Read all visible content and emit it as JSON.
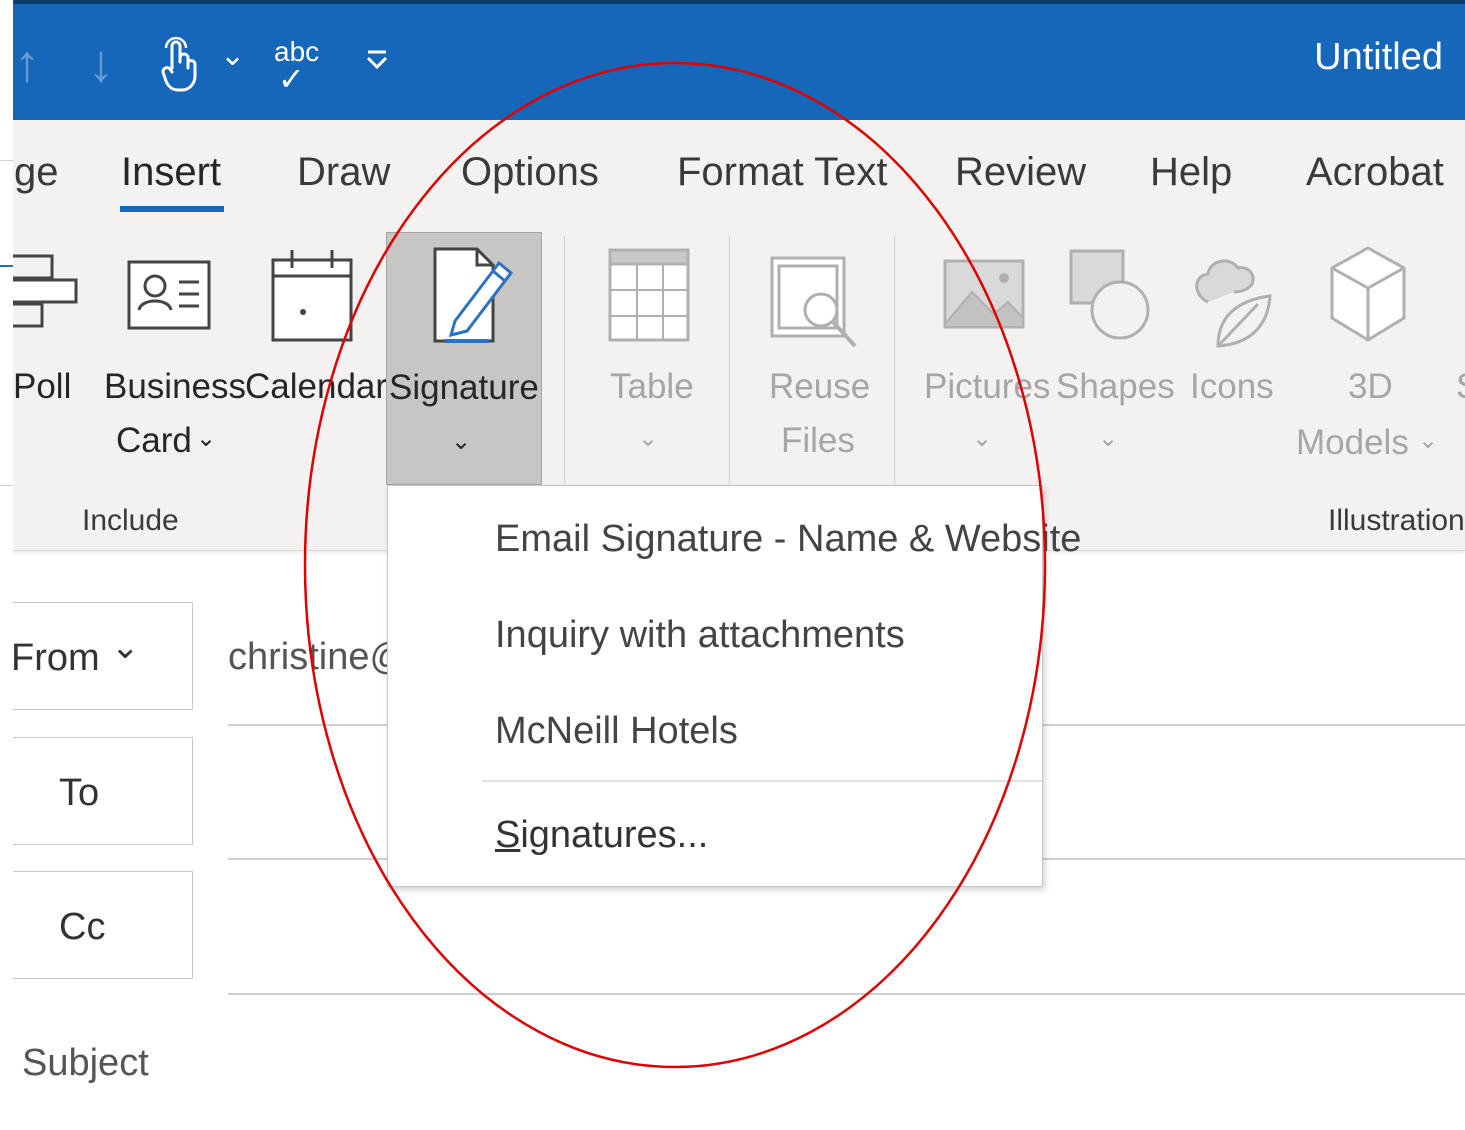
{
  "window": {
    "title": "Untitled"
  },
  "quick_access": {
    "undo": "↑",
    "redo": "↓",
    "touch": "☝",
    "touch_dropdown": "⌄",
    "spelling_top": "abc",
    "spelling_check": "✓",
    "customize": "⏷"
  },
  "tabs": [
    "ge",
    "Insert",
    "Draw",
    "Options",
    "Format Text",
    "Review",
    "Help",
    "Acrobat"
  ],
  "active_tab": "Insert",
  "ribbon": {
    "poll": "Poll",
    "business_card_1": "Business",
    "business_card_2": "Card",
    "calendar": "Calendar",
    "signature": "Signature",
    "table": "Table",
    "reuse_files_1": "Reuse",
    "reuse_files_2": "Files",
    "pictures": "Pictures",
    "shapes": "Shapes",
    "icons": "Icons",
    "models_1": "3D",
    "models_2": "Models",
    "chevron": "⌄",
    "group_include": "Include",
    "group_illustrations": "Illustration"
  },
  "signature_menu": {
    "items": [
      "Email Signature - Name & Website",
      "Inquiry with attachments",
      "McNeill Hotels"
    ],
    "manage_prefix": "S",
    "manage_rest": "ignatures..."
  },
  "compose": {
    "from_label": "From",
    "from_chevron": "⌄",
    "from_value": "christine@",
    "to_label": "To",
    "cc_label": "Cc",
    "subject_label": "Subject"
  },
  "colors": {
    "titlebar": "#1667b9",
    "ribbon": "#f3f2f1",
    "accent": "#1667b9",
    "annotation_oval": "#e00000"
  }
}
